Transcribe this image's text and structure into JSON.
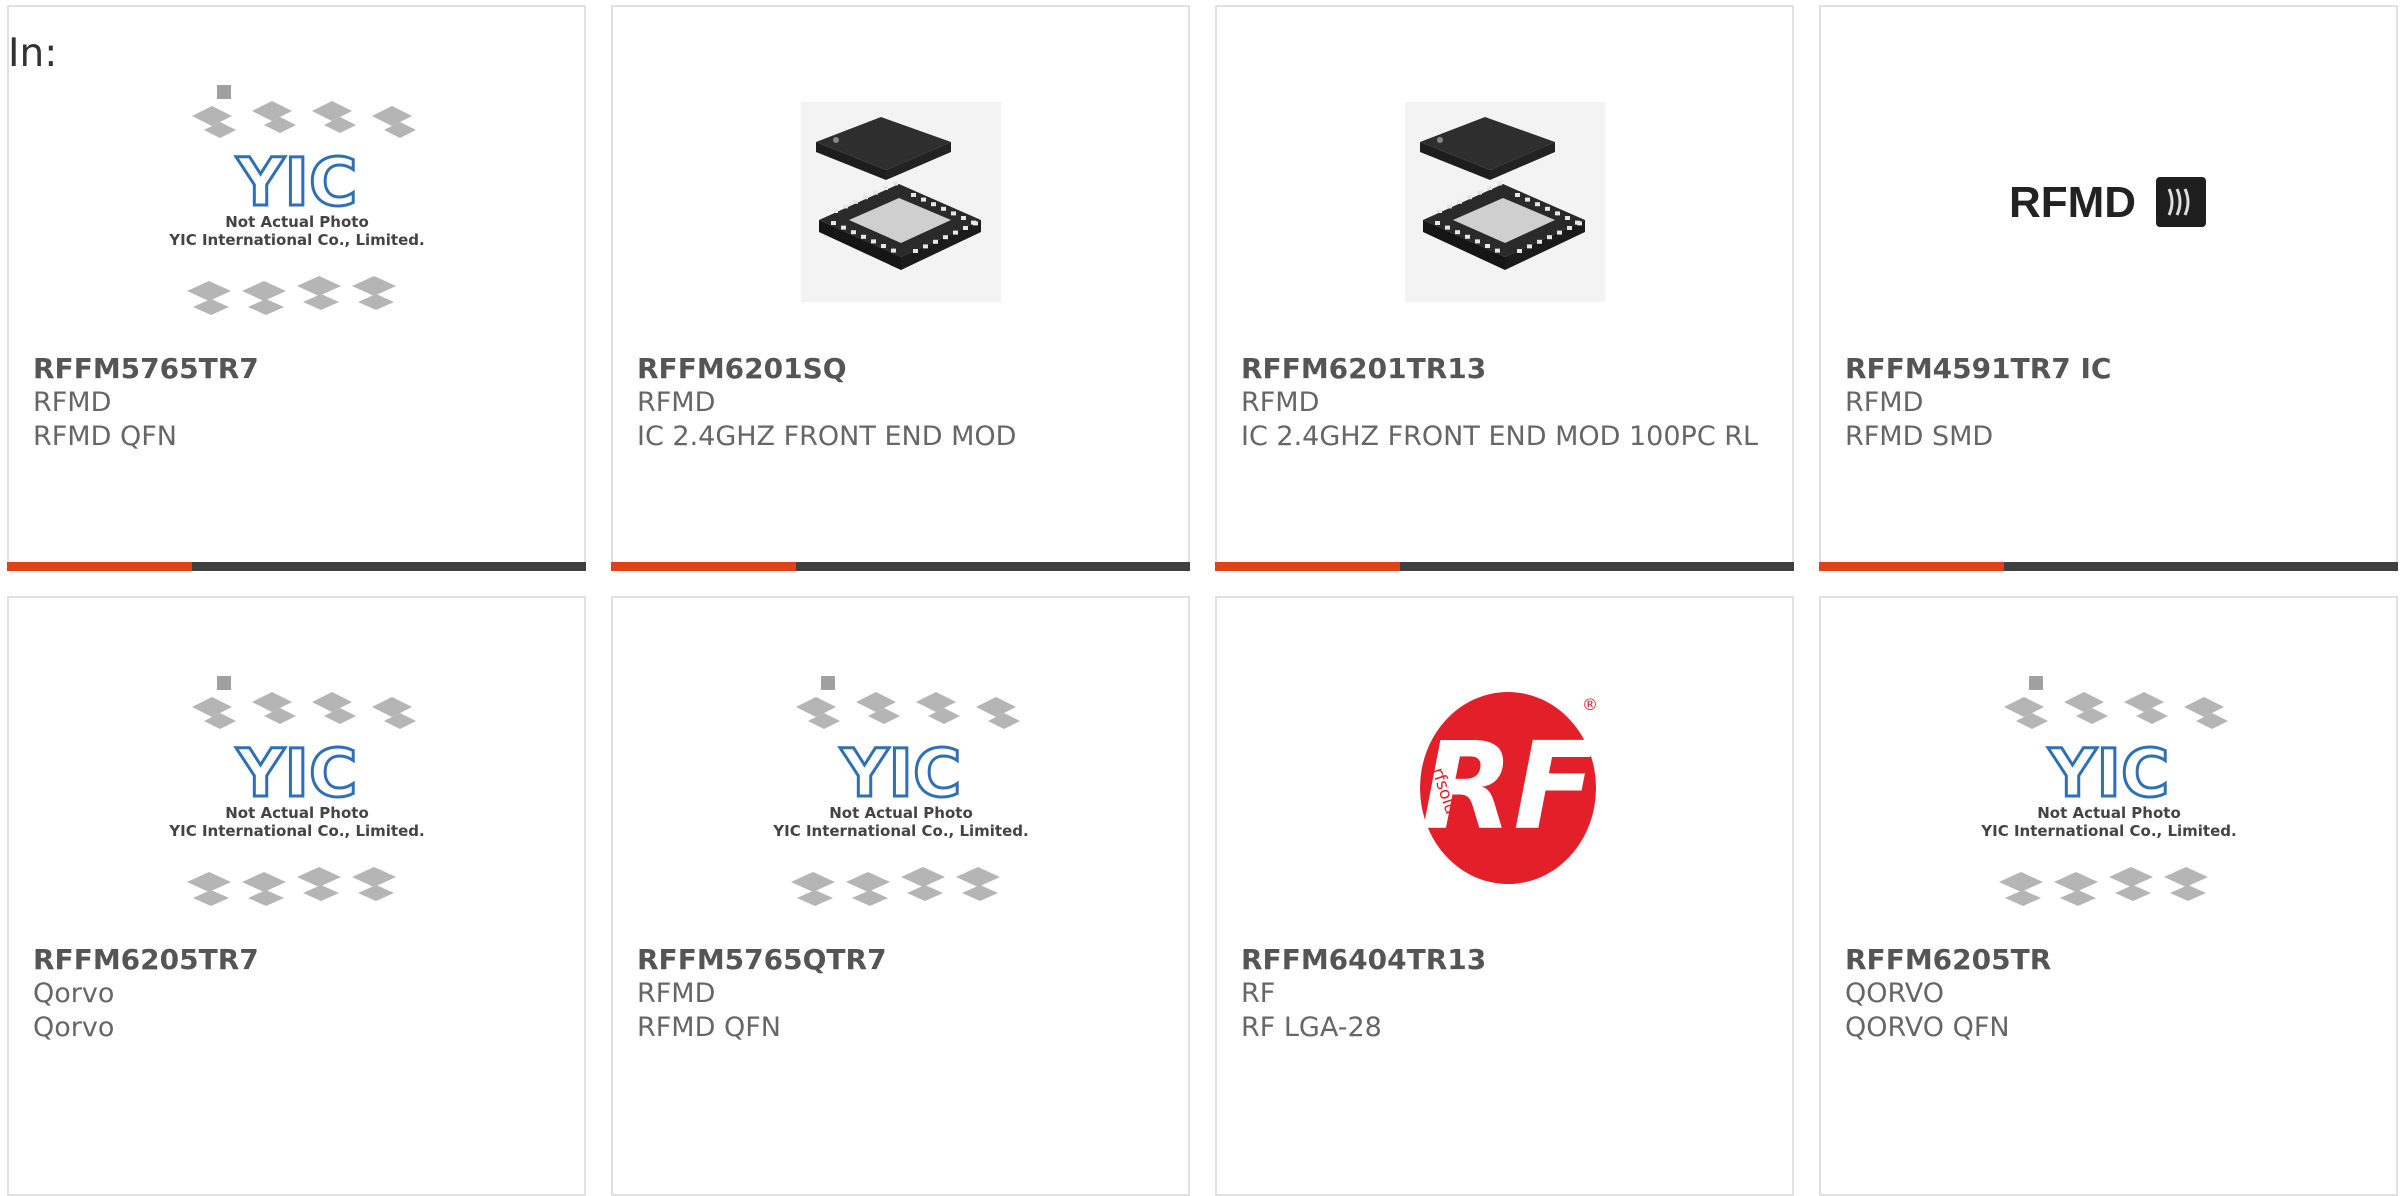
{
  "page": {
    "label": "In:"
  },
  "products": [
    {
      "part_no": "RFFM5765TR7",
      "manufacturer": "RFMD",
      "description": "RFMD QFN",
      "image": "placeholder",
      "placeholder_lines": [
        "Not Actual Photo",
        "YIC International Co., Limited."
      ],
      "placeholder_logo": "YIC",
      "accent_progress": 0.32
    },
    {
      "part_no": "RFFM6201SQ",
      "manufacturer": "RFMD",
      "description": "IC 2.4GHZ FRONT END MOD",
      "image": "qfn-chip",
      "accent_progress": 0.32
    },
    {
      "part_no": "RFFM6201TR13",
      "manufacturer": "RFMD",
      "description": "IC 2.4GHZ FRONT END MOD 100PC RL",
      "image": "qfn-chip",
      "accent_progress": 0.32
    },
    {
      "part_no": "RFFM4591TR7 IC",
      "manufacturer": "RFMD",
      "description": "RFMD SMD",
      "image": "rfmd-logo",
      "logo_text": "RFMD",
      "accent_progress": 0.32
    },
    {
      "part_no": "RFFM6205TR7",
      "manufacturer": "Qorvo",
      "description": "Qorvo",
      "image": "placeholder",
      "placeholder_lines": [
        "Not Actual Photo",
        "YIC International Co., Limited."
      ],
      "placeholder_logo": "YIC"
    },
    {
      "part_no": "RFFM5765QTR7",
      "manufacturer": "RFMD",
      "description": "RFMD QFN",
      "image": "placeholder",
      "placeholder_lines": [
        "Not Actual Photo",
        "YIC International Co., Limited."
      ],
      "placeholder_logo": "YIC"
    },
    {
      "part_no": "RFFM6404TR13",
      "manufacturer": "RF",
      "description": "RF LGA-28",
      "image": "rf-solutions-logo",
      "logo_text": "RF",
      "logo_subtext": "rfsolutions",
      "logo_mark": "®"
    },
    {
      "part_no": "RFFM6205TR",
      "manufacturer": "QORVO",
      "description": "QORVO QFN",
      "image": "placeholder",
      "placeholder_lines": [
        "Not Actual Photo",
        "YIC International Co., Limited."
      ],
      "placeholder_logo": "YIC"
    }
  ],
  "colors": {
    "accent": "#e0401c",
    "accent_track": "#404040",
    "card_border": "#e1e1e1",
    "text": "#5f5f5f",
    "yic_blue": "#2f6fb5",
    "rf_red": "#e3202a"
  }
}
